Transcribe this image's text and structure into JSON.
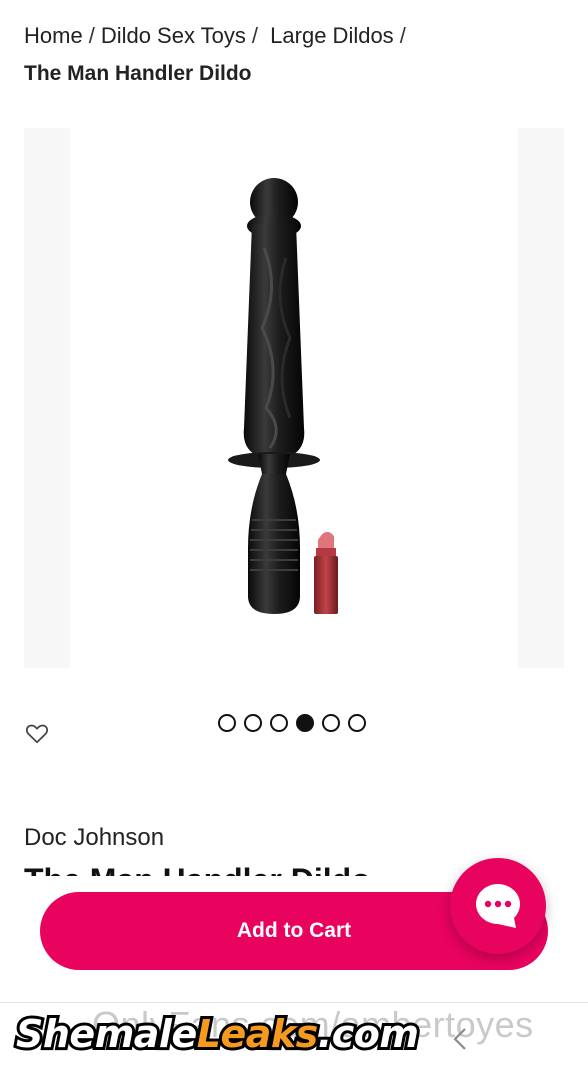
{
  "breadcrumb": {
    "items": [
      "Home",
      "Dildo Sex Toys",
      "Large Dildos"
    ],
    "separator": "/",
    "current": "The Man Handler Dildo"
  },
  "gallery": {
    "image": "product-photo-black-handle-dildo-with-lipstick",
    "slide_count": 6,
    "active_slide": 4
  },
  "product": {
    "brand": "Doc Johnson",
    "title": "The Man Handler Dildo"
  },
  "actions": {
    "add_to_cart_label": "Add to Cart",
    "wishlist_icon": "heart-icon",
    "chat_icon": "chat-bubble-icon"
  },
  "watermark": {
    "url_text": "OnlyFans.com/ambertoyes",
    "logo_part1": "Shemale",
    "logo_part2": "Leaks",
    "logo_part3": ".com"
  },
  "colors": {
    "accent": "#e8035f",
    "logo_orange": "#f59a1e"
  }
}
